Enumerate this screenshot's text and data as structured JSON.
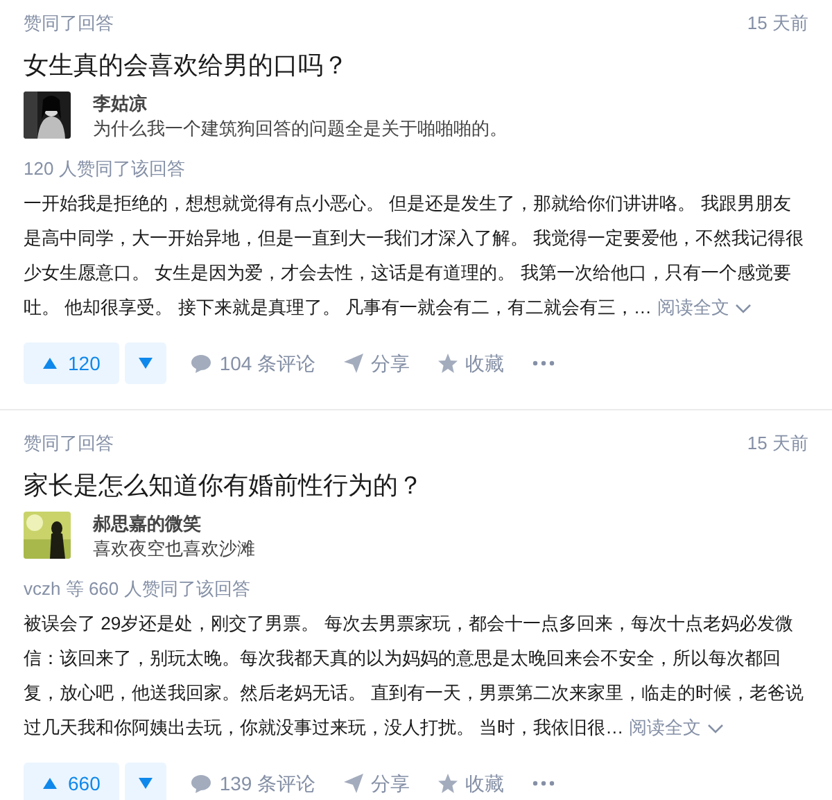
{
  "feed": [
    {
      "action": "赞同了回答",
      "time": "15 天前",
      "question": "女生真的会喜欢给男的口吗？",
      "author": {
        "name": "李姑凉",
        "bio": "为什么我一个建筑狗回答的问题全是关于啪啪啪的。"
      },
      "vote_info": "120 人赞同了该回答",
      "excerpt": "一开始我是拒绝的，想想就觉得有点小恶心。 但是还是发生了，那就给你们讲讲咯。 我跟男朋友是高中同学，大一开始异地，但是一直到大一我们才深入了解。 我觉得一定要爱他，不然我记得很少女生愿意口。 女生是因为爱，才会去性，这话是有道理的。 我第一次给他口，只有一个感觉要吐。 他却很享受。 接下来就是真理了。 凡事有一就会有二，有二就会有三，…",
      "read_more": "阅读全文",
      "upvotes": "120",
      "comments": "104 条评论",
      "share": "分享",
      "favorite": "收藏"
    },
    {
      "action": "赞同了回答",
      "time": "15 天前",
      "question": "家长是怎么知道你有婚前性行为的？",
      "author": {
        "name": "郝思嘉的微笑",
        "bio": "喜欢夜空也喜欢沙滩"
      },
      "vote_info": "vczh 等 660 人赞同了该回答",
      "excerpt": "被误会了 29岁还是处，刚交了男票。 每次去男票家玩，都会十一点多回来，每次十点老妈必发微信：该回来了，别玩太晚。每次我都天真的以为妈妈的意思是太晚回来会不安全，所以每次都回复，放心吧，他送我回家。然后老妈无话。 直到有一天，男票第二次来家里，临走的时候，老爸说过几天我和你阿姨出去玩，你就没事过来玩，没人打扰。 当时，我依旧很…",
      "read_more": "阅读全文",
      "upvotes": "660",
      "comments": "139 条评论",
      "share": "分享",
      "favorite": "收藏"
    }
  ]
}
